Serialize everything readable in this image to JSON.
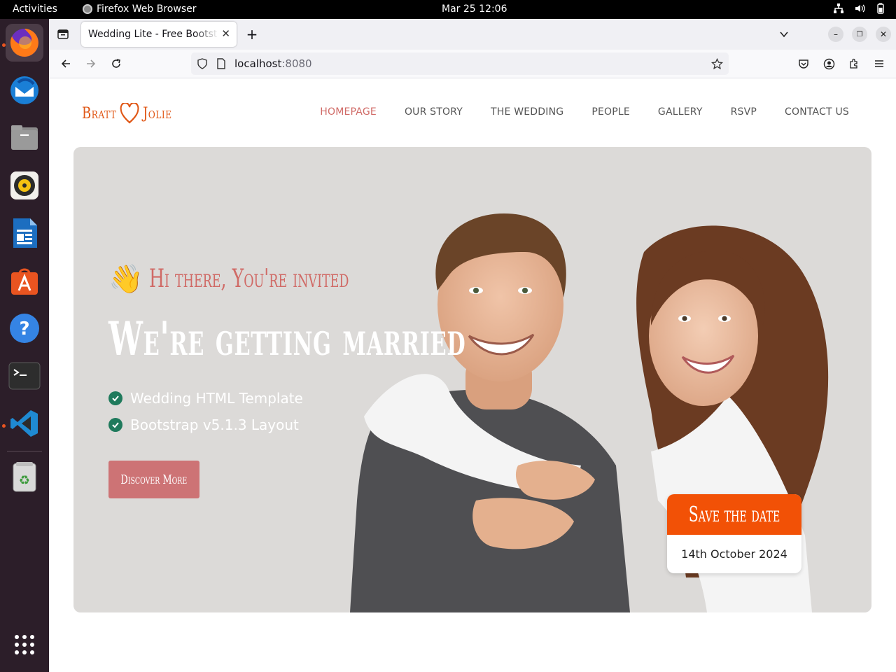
{
  "system": {
    "activities": "Activities",
    "app_name": "Firefox Web Browser",
    "clock": "Mar 25  12:06"
  },
  "dock": {
    "items": [
      "Firefox",
      "Thunderbird",
      "Files",
      "Rhythmbox",
      "LibreOffice Writer",
      "Ubuntu Software",
      "Help",
      "Terminal",
      "Visual Studio Code",
      "Trash",
      "Show Applications"
    ]
  },
  "browser": {
    "tab_title": "Wedding Lite - Free Bootstrap",
    "url_host": "localhost",
    "url_port": ":8080"
  },
  "site": {
    "logo_left": "Bratt",
    "logo_right": "Jolie",
    "nav": [
      "HOMEPAGE",
      "OUR STORY",
      "THE WEDDING",
      "PEOPLE",
      "GALLERY",
      "RSVP",
      "CONTACT US"
    ],
    "hero": {
      "greeting": "Hi there, You're invited",
      "headline": "We're getting married",
      "features": [
        "Wedding HTML Template",
        "Bootstrap v5.1.3 Layout"
      ],
      "button": "Discover More",
      "save_title": "Save the date",
      "save_date": "14th October 2024"
    }
  },
  "colors": {
    "accent": "#d06a66",
    "logo": "#e05716",
    "save_header": "#f25106",
    "hero_bg": "#dcdad8",
    "check": "#1f7a5c"
  }
}
